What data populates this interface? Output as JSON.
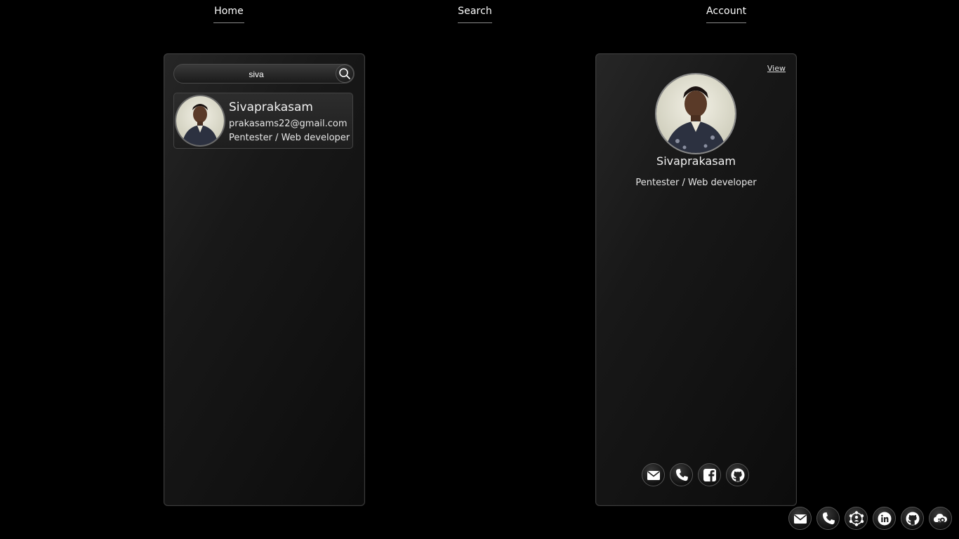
{
  "nav": {
    "home_label": "Home",
    "search_label": "Search",
    "account_label": "Account"
  },
  "search": {
    "query": "siva",
    "icon": "search-icon"
  },
  "results": [
    {
      "name": "Sivaprakasam",
      "email": "prakasams22@gmail.com",
      "role": "Pentester / Web developer"
    }
  ],
  "profile": {
    "view_label": "View",
    "name": "Sivaprakasam",
    "role": "Pentester / Web developer",
    "socials": [
      "email-icon",
      "phone-icon",
      "facebook-icon",
      "github-icon"
    ]
  },
  "footer": {
    "socials": [
      "email-icon",
      "phone-icon",
      "network-icon",
      "linkedin-icon",
      "github-icon",
      "cloud-icon"
    ]
  },
  "colors": {
    "background": "#000000",
    "panel": "#1a1a1a",
    "text": "#ffffff"
  }
}
